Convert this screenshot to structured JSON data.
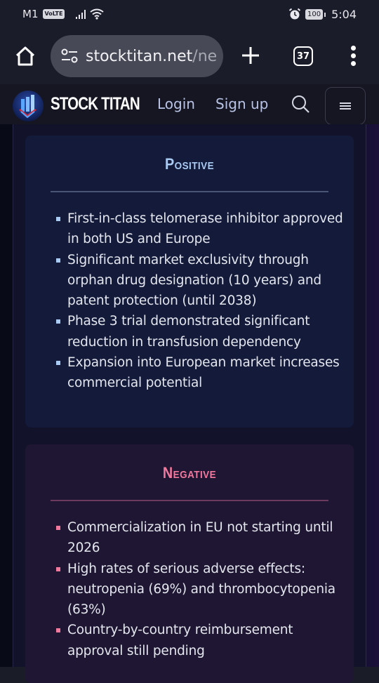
{
  "status_bar": {
    "carrier": "M1",
    "volte": "VoLTE",
    "battery": "100",
    "time": "5:04",
    "icons": [
      "signal-icon",
      "wifi-icon",
      "alarm-icon",
      "battery-icon"
    ]
  },
  "browser": {
    "url_main": "stocktitan.net",
    "url_rest": "/ne",
    "tab_count": "37"
  },
  "site": {
    "brand": "STOCK TITAN",
    "nav": {
      "login": "Login",
      "signup": "Sign up"
    }
  },
  "positive": {
    "title": "Positive",
    "accent": "#a9caf2",
    "items": [
      "First-in-class telomerase inhibitor approved in both US and Europe",
      "Significant market exclusivity through orphan drug designation (10 years) and patent protection (until 2038)",
      "Phase 3 trial demonstrated significant reduction in transfusion dependency",
      "Expansion into European market increases commercial potential"
    ]
  },
  "negative": {
    "title": "Negative",
    "accent": "#f2799e",
    "items": [
      "Commercialization in EU not starting until 2026",
      "High rates of serious adverse effects: neutropenia (69%) and thrombocytopenia (63%)",
      "Country-by-country reimbursement approval still pending"
    ]
  }
}
